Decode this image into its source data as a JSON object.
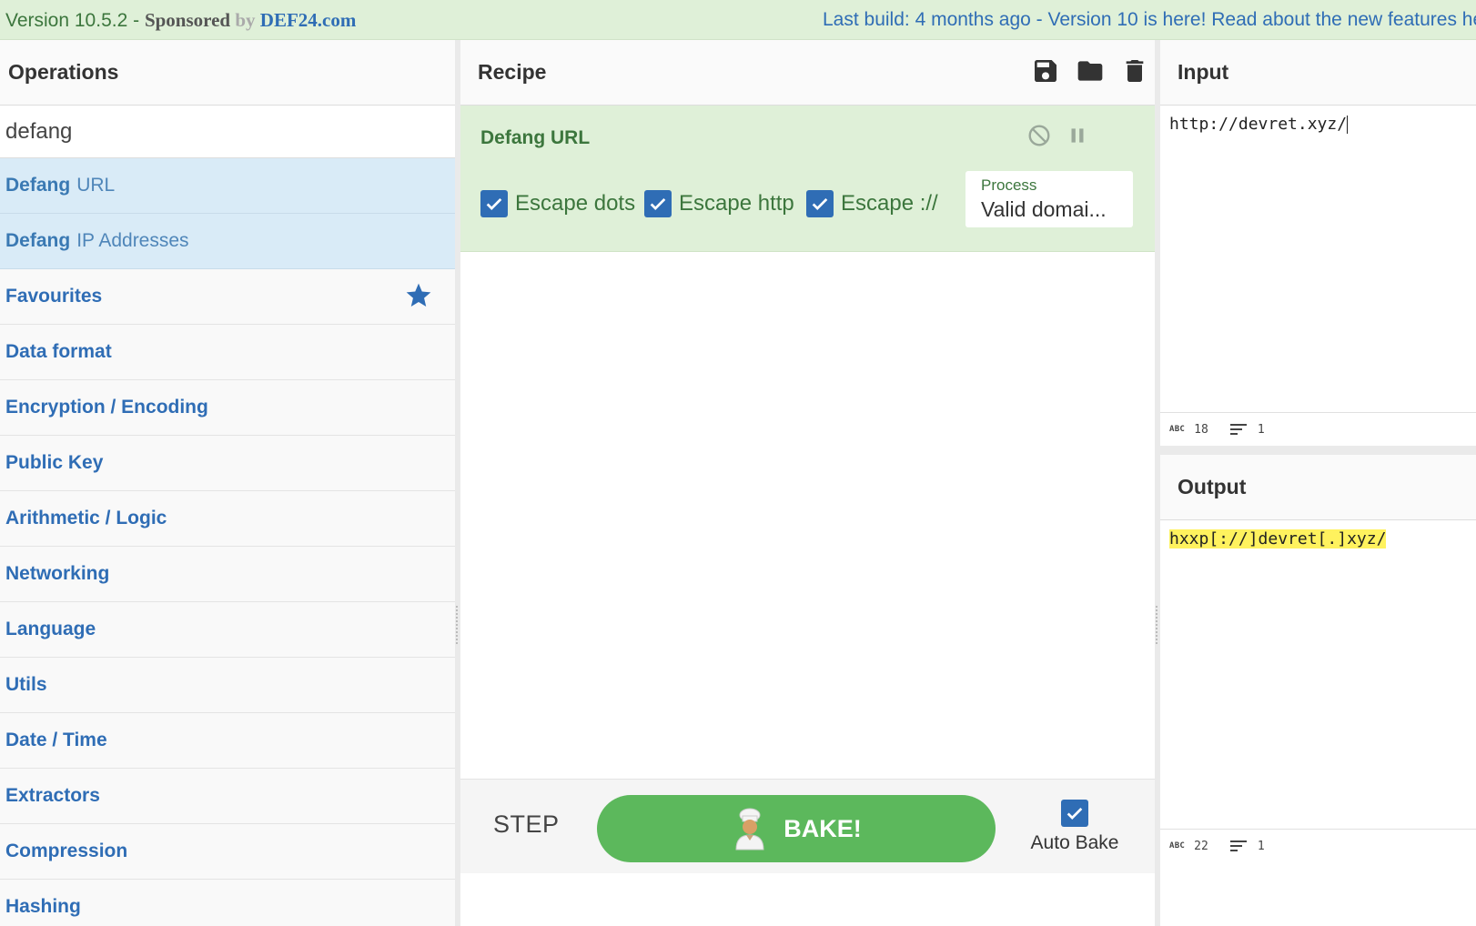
{
  "banner": {
    "version": "Version 10.5.2 - ",
    "sponsored": "Sponsored",
    "by": " by ",
    "sponsor_brand": "DEF24.com",
    "news": "Last build: 4 months ago - Version 10 is here! Read about the new features he"
  },
  "operations": {
    "title": "Operations",
    "search_value": "defang",
    "results": [
      {
        "match": "Defang",
        "rest": "URL"
      },
      {
        "match": "Defang",
        "rest": "IP Addresses"
      }
    ],
    "categories": [
      "Favourites",
      "Data format",
      "Encryption / Encoding",
      "Public Key",
      "Arithmetic / Logic",
      "Networking",
      "Language",
      "Utils",
      "Date / Time",
      "Extractors",
      "Compression",
      "Hashing"
    ]
  },
  "recipe": {
    "title": "Recipe",
    "icons": [
      "save-icon",
      "folder-icon",
      "trash-icon"
    ],
    "operation": {
      "name": "Defang URL",
      "escape_dots": {
        "label": "Escape dots",
        "checked": true
      },
      "escape_http": {
        "label": "Escape http",
        "checked": true
      },
      "escape_slashes": {
        "label": "Escape ://",
        "checked": true
      },
      "process": {
        "label": "Process",
        "value": "Valid domai..."
      }
    },
    "controls": {
      "step": "STEP",
      "bake": "BAKE!",
      "auto_bake": "Auto Bake",
      "auto_bake_checked": true
    }
  },
  "input": {
    "title": "Input",
    "value": "http://devret.xyz/",
    "chars": "18",
    "lines": "1"
  },
  "output": {
    "title": "Output",
    "value": "hxxp[://]devret[.]xyz/",
    "chars": "22",
    "lines": "1"
  },
  "colors": {
    "banner_bg": "#dff0d8",
    "link_blue": "#2f6db5",
    "recipe_green": "#3c763d",
    "bake_green": "#5cb85c",
    "output_highlight": "#fff25e"
  }
}
